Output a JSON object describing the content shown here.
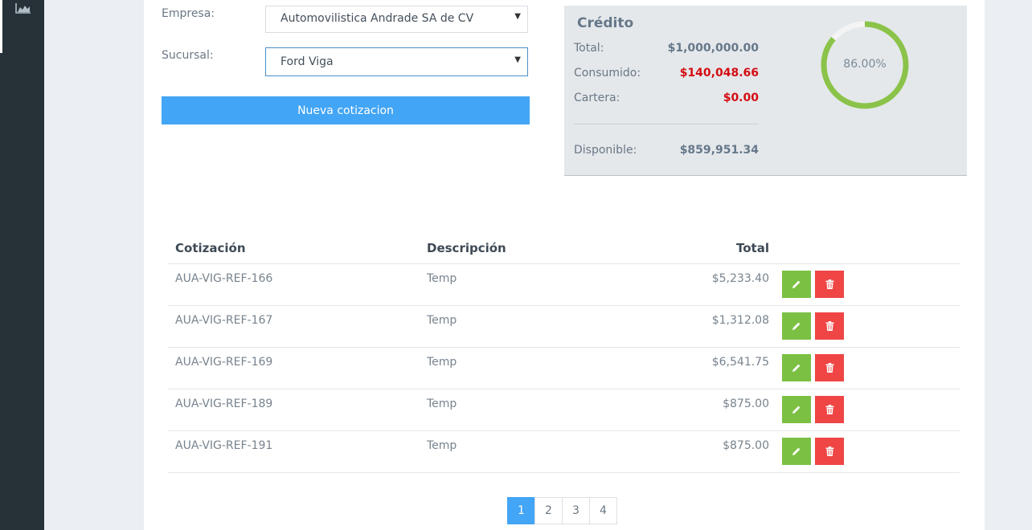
{
  "sidebar": {
    "icon": "area-chart-icon"
  },
  "form": {
    "empresa_label": "Empresa:",
    "empresa_value": "Automovilistica Andrade SA de CV",
    "sucursal_label": "Sucursal:",
    "sucursal_value": "Ford Viga",
    "new_button": "Nueva cotizacion"
  },
  "credit": {
    "title": "Crédito",
    "rows": [
      {
        "label": "Total:",
        "value": "$1,000,000.00"
      },
      {
        "label": "Consumido:",
        "value": "$140,048.66"
      },
      {
        "label": "Cartera:",
        "value": "$0.00"
      }
    ],
    "available_label": "Disponible:",
    "available_value": "$859,951.34",
    "percent_label": "86.00%",
    "percent_value": 0.86,
    "colors": {
      "ring": "#8bc34a",
      "track": "#f4f4f4",
      "negative": "#d40d12"
    }
  },
  "table": {
    "headers": {
      "quote": "Cotización",
      "description": "Descripción",
      "total": "Total"
    },
    "rows": [
      {
        "quote": "AUA-VIG-REF-166",
        "description": "Temp",
        "total": "$5,233.40"
      },
      {
        "quote": "AUA-VIG-REF-167",
        "description": "Temp",
        "total": "$1,312.08"
      },
      {
        "quote": "AUA-VIG-REF-169",
        "description": "Temp",
        "total": "$6,541.75"
      },
      {
        "quote": "AUA-VIG-REF-189",
        "description": "Temp",
        "total": "$875.00"
      },
      {
        "quote": "AUA-VIG-REF-191",
        "description": "Temp",
        "total": "$875.00"
      }
    ],
    "row_actions": {
      "edit_icon": "pencil-icon",
      "delete_icon": "trash-icon"
    }
  },
  "pagination": {
    "pages": [
      "1",
      "2",
      "3",
      "4"
    ],
    "current": "1"
  }
}
